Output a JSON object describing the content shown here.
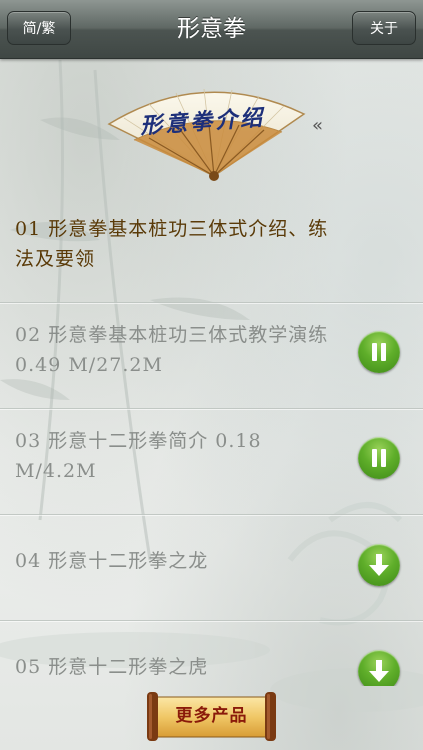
{
  "nav": {
    "left_button": "简/繁",
    "title": "形意拳",
    "right_button": "关于"
  },
  "banner": {
    "title": "形意拳介绍",
    "chevron": "«"
  },
  "items": [
    {
      "text": "01  形意拳基本桩功三体式介绍、练法及要领",
      "state": "selected",
      "icon": null
    },
    {
      "text": "02  形意拳基本桩功三体式教学演练  0.49 M/27.2M",
      "state": "downloading",
      "icon": "pause-icon"
    },
    {
      "text": "03  形意十二形拳简介  0.18 M/4.2M",
      "state": "downloading",
      "icon": "pause-icon"
    },
    {
      "text": "04  形意十二形拳之龙",
      "state": "idle",
      "icon": "download-icon"
    },
    {
      "text": "05  形意十二形拳之虎",
      "state": "idle",
      "icon": "download-icon"
    }
  ],
  "more_button": "更多产品",
  "colors": {
    "accent_green": "#5fae2a",
    "selected_text": "#5a3a08",
    "normal_text": "#8a8e8b",
    "fan_text": "#1d2f7a"
  }
}
